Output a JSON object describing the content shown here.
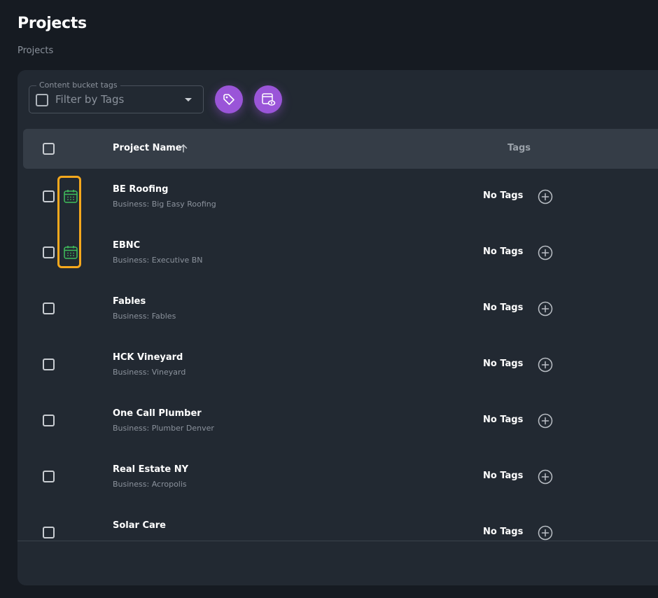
{
  "page": {
    "title": "Projects",
    "breadcrumb": "Projects"
  },
  "filter": {
    "legend": "Content bucket tags",
    "placeholder": "Filter by Tags"
  },
  "toolbar": {
    "tag_button_icon": "tag-icon",
    "preview_button_icon": "window-eye-icon"
  },
  "table": {
    "headers": {
      "name": "Project Name",
      "tags": "Tags"
    },
    "sort": "ascending",
    "rows": [
      {
        "name": "BE Roofing",
        "business": "Business: Big Easy Roofing",
        "tags": "No Tags",
        "scheduled": true
      },
      {
        "name": "EBNC",
        "business": "Business: Executive BN",
        "tags": "No Tags",
        "scheduled": true
      },
      {
        "name": "Fables",
        "business": "Business: Fables",
        "tags": "No Tags",
        "scheduled": false
      },
      {
        "name": "HCK Vineyard",
        "business": "Business: Vineyard",
        "tags": "No Tags",
        "scheduled": false
      },
      {
        "name": "One Call Plumber",
        "business": "Business: Plumber Denver",
        "tags": "No Tags",
        "scheduled": false
      },
      {
        "name": "Real Estate NY",
        "business": "Business: Acropolis",
        "tags": "No Tags",
        "scheduled": false
      },
      {
        "name": "Solar Care",
        "business": "",
        "tags": "No Tags",
        "scheduled": false
      }
    ]
  },
  "colors": {
    "accent": "#9a55d8",
    "calendar_icon": "#3fbf5c",
    "highlight": "#f6a81d",
    "background": "#161b22",
    "card": "#222932"
  }
}
